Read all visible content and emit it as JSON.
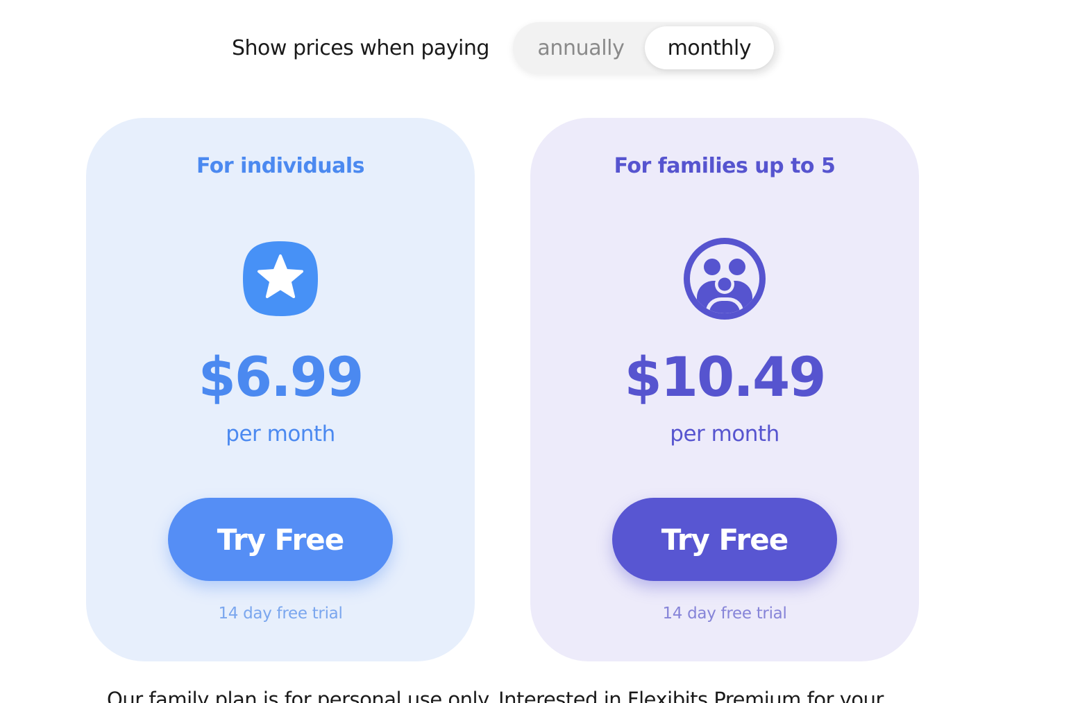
{
  "billing_toggle": {
    "label": "Show prices when paying",
    "options": [
      "annually",
      "monthly"
    ],
    "selected": "monthly"
  },
  "plans": [
    {
      "title": "For individuals",
      "icon": "star-icon",
      "price": "$6.99",
      "period": "per month",
      "button_label": "Try Free",
      "trial_note": "14 day free trial",
      "accent_color": "#558ef5",
      "card_color": "#e7effc"
    },
    {
      "title": "For families up to 5",
      "icon": "family-icon",
      "price": "$10.49",
      "period": "per month",
      "button_label": "Try Free",
      "trial_note": "14 day free trial",
      "accent_color": "#5856d2",
      "card_color": "#edebfa"
    }
  ],
  "footnote": "Our family plan is for personal use only. Interested in Flexibits Premium for your"
}
